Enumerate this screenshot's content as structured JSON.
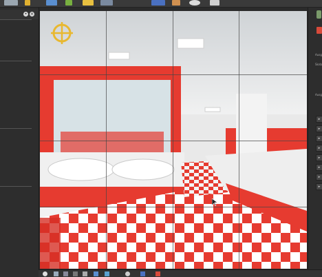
{
  "toolbar": {
    "icons": [
      "window-icon",
      "paint-icon",
      "color-icon",
      "mesh-icon",
      "binoculars-icon",
      "notes-icon",
      "sphere-icon",
      "render-icon"
    ]
  },
  "left_panel": {
    "close_glyph": "×",
    "pin_glyph": "•"
  },
  "viewport": {
    "cursor_marker": "target-icon"
  },
  "right_panel": {
    "labels": [
      "Ausg",
      "Sknb",
      "Ausg"
    ],
    "arrow_glyph": "▸",
    "arrow_count": 10
  },
  "colors": {
    "accent_red": "#e2342c",
    "tile_red": "#e63b30",
    "white_tile": "#ffffff",
    "panel_bg": "#2d2d2d"
  }
}
